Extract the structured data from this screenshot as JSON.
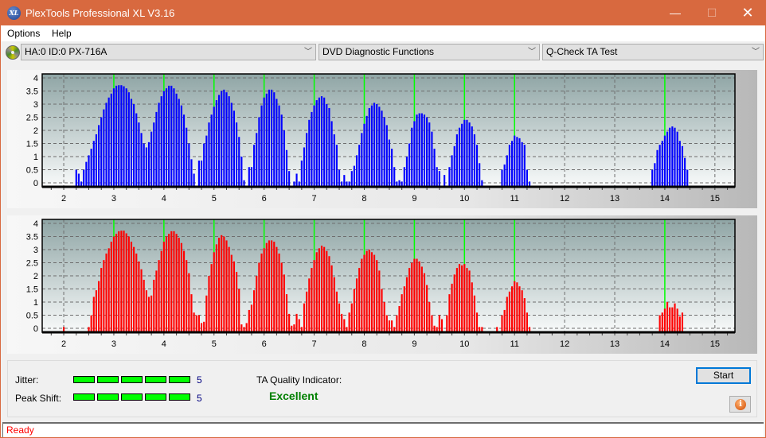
{
  "window": {
    "title": "PlexTools Professional XL V3.16",
    "logo_text": "XL",
    "controls": {
      "minimize": "—",
      "maximize": "☐",
      "close": "✕"
    }
  },
  "menu": {
    "items": [
      "Options",
      "Help"
    ]
  },
  "toolbar": {
    "drive": "HA:0 ID:0  PX-716A",
    "function": "DVD Diagnostic Functions",
    "test": "Q-Check TA Test"
  },
  "chart_data": [
    {
      "type": "bar",
      "name": "top-ta-histogram",
      "color": "#0000ff",
      "x_start": 2.25,
      "x_step": 0.05,
      "xlim": [
        1.57,
        15.4
      ],
      "ylim": [
        -0.15,
        4.15
      ],
      "x_ticks": [
        2,
        3,
        4,
        5,
        6,
        7,
        8,
        9,
        10,
        11,
        12,
        13,
        14,
        15
      ],
      "y_ticks": [
        0,
        0.5,
        1,
        1.5,
        2,
        2.5,
        3,
        3.5,
        4
      ],
      "y_tick_labels": [
        "0",
        "0.5",
        "1",
        "1.5",
        "2",
        "2.5",
        "3",
        "3.5",
        "4"
      ],
      "reference_lines": [
        3,
        4,
        5,
        6,
        7,
        8,
        9,
        10,
        11,
        14
      ],
      "reference_color": "#00ff00",
      "grid": true,
      "values": [
        0.5,
        0.35,
        0.05,
        0.5,
        0.8,
        1.05,
        1.3,
        1.6,
        1.85,
        2.2,
        2.5,
        2.8,
        3.05,
        3.25,
        3.4,
        3.6,
        3.7,
        3.72,
        3.72,
        3.68,
        3.6,
        3.45,
        3.2,
        3.0,
        2.65,
        2.3,
        1.9,
        1.5,
        1.35,
        1.55,
        1.95,
        2.3,
        2.7,
        3.05,
        3.3,
        3.5,
        3.6,
        3.7,
        3.7,
        3.6,
        3.4,
        3.2,
        2.95,
        2.6,
        2.1,
        1.5,
        0.9,
        0.35,
        0.0,
        0.85,
        0.85,
        1.5,
        1.8,
        2.3,
        2.6,
        2.9,
        3.15,
        3.35,
        3.5,
        3.55,
        3.45,
        3.3,
        3.05,
        2.75,
        2.3,
        1.75,
        1.0,
        0.1,
        0.0,
        0.6,
        0.6,
        1.45,
        1.9,
        2.5,
        2.95,
        3.25,
        3.4,
        3.55,
        3.55,
        3.45,
        3.2,
        2.95,
        2.6,
        2.0,
        1.25,
        0.45,
        0.0,
        0.05,
        0.35,
        0.05,
        0.85,
        1.35,
        1.9,
        2.4,
        2.7,
        2.95,
        3.15,
        3.25,
        3.3,
        3.25,
        3.0,
        2.85,
        2.35,
        1.85,
        1.45,
        0.5,
        0.05,
        0.3,
        0.05,
        0.05,
        0.45,
        0.65,
        1.05,
        1.45,
        1.9,
        2.25,
        2.55,
        2.85,
        2.95,
        3.05,
        3.0,
        2.9,
        2.75,
        2.5,
        2.2,
        1.65,
        1.3,
        0.6,
        0.05,
        0.1,
        0.05,
        0.6,
        1.0,
        1.5,
        2.1,
        2.35,
        2.6,
        2.65,
        2.65,
        2.6,
        2.5,
        2.3,
        1.95,
        1.3,
        0.6,
        0.45,
        0.0,
        0.3,
        0.0,
        0.6,
        1.05,
        1.4,
        1.85,
        2.1,
        2.25,
        2.4,
        2.4,
        2.3,
        2.15,
        1.85,
        1.45,
        0.75,
        0.1,
        0.0,
        0.0,
        0.0,
        0.0,
        0.0,
        0.0,
        0.0,
        0.5,
        0.7,
        1.05,
        1.45,
        1.6,
        1.8,
        1.75,
        1.7,
        1.55,
        1.45,
        0.5,
        0.05,
        0.0
      ],
      "values_end_x": 11.45,
      "extra_group": {
        "x_start": 13.75,
        "values": [
          0.5,
          0.75,
          1.25,
          1.45,
          1.6,
          1.8,
          1.95,
          2.1,
          2.15,
          2.1,
          1.95,
          1.6,
          1.4,
          0.95,
          0.5
        ]
      }
    },
    {
      "type": "bar",
      "name": "bottom-ta-histogram",
      "color": "#ff0000",
      "x_start": 2.25,
      "x_step": 0.05,
      "xlim": [
        1.57,
        15.4
      ],
      "ylim": [
        -0.15,
        4.15
      ],
      "x_ticks": [
        2,
        3,
        4,
        5,
        6,
        7,
        8,
        9,
        10,
        11,
        12,
        13,
        14,
        15
      ],
      "y_ticks": [
        0,
        0.5,
        1,
        1.5,
        2,
        2.5,
        3,
        3.5,
        4
      ],
      "y_tick_labels": [
        "0",
        "0.5",
        "1",
        "1.5",
        "2",
        "2.5",
        "3",
        "3.5",
        "4"
      ],
      "reference_lines": [
        3,
        4,
        5,
        6,
        7,
        8,
        9,
        10,
        11,
        14
      ],
      "reference_color": "#00ff00",
      "grid": true,
      "single_points": [
        {
          "x": 2.0,
          "value": 0.05
        }
      ],
      "values": [
        0.0,
        0.0,
        0.0,
        0.0,
        0.0,
        0.05,
        0.5,
        1.2,
        1.45,
        1.8,
        2.3,
        2.6,
        2.85,
        3.05,
        3.3,
        3.5,
        3.6,
        3.7,
        3.72,
        3.72,
        3.62,
        3.5,
        3.3,
        3.1,
        2.85,
        2.55,
        2.25,
        1.85,
        1.45,
        1.2,
        1.25,
        1.85,
        2.2,
        2.6,
        2.95,
        3.3,
        3.5,
        3.6,
        3.7,
        3.7,
        3.6,
        3.45,
        3.25,
        2.95,
        2.6,
        2.1,
        1.3,
        0.6,
        0.5,
        0.5,
        0.2,
        0.25,
        1.25,
        2.0,
        2.45,
        2.9,
        3.2,
        3.45,
        3.55,
        3.5,
        3.35,
        3.1,
        2.8,
        2.55,
        2.15,
        1.5,
        0.15,
        0.05,
        0.2,
        0.7,
        0.9,
        1.45,
        2.0,
        2.5,
        2.85,
        3.05,
        3.25,
        3.35,
        3.35,
        3.3,
        3.1,
        2.85,
        2.5,
        2.05,
        1.3,
        0.55,
        0.1,
        0.15,
        0.55,
        0.35,
        0.05,
        0.95,
        1.4,
        1.9,
        2.3,
        2.6,
        2.9,
        3.05,
        3.15,
        3.1,
        2.95,
        2.75,
        2.4,
        1.95,
        1.4,
        0.95,
        0.55,
        0.35,
        0.05,
        0.6,
        0.95,
        1.5,
        1.9,
        2.3,
        2.65,
        2.8,
        2.95,
        3.0,
        2.9,
        2.8,
        2.6,
        2.2,
        1.5,
        1.0,
        0.5,
        0.3,
        0.3,
        0.05,
        0.5,
        0.85,
        1.3,
        1.6,
        1.95,
        2.3,
        2.5,
        2.65,
        2.65,
        2.55,
        2.35,
        2.1,
        1.65,
        1.0,
        0.5,
        0.1,
        0.05,
        0.5,
        0.35,
        0.0,
        0.5,
        1.3,
        1.7,
        2.05,
        2.3,
        2.45,
        2.4,
        2.45,
        2.3,
        2.2,
        1.75,
        1.25,
        0.6,
        0.05,
        0.05,
        0.0,
        0.0,
        0.0,
        0.0,
        0.0,
        0.05,
        0.0,
        0.5,
        0.7,
        1.2,
        1.4,
        1.6,
        1.8,
        1.75,
        1.6,
        1.45,
        1.15,
        0.6,
        0.05
      ],
      "values_end_x": 11.5,
      "extra_group": {
        "x_start": 13.9,
        "values": [
          0.5,
          0.6,
          0.75,
          1.0,
          0.8,
          0.8,
          0.95,
          0.75,
          0.45,
          0.6
        ]
      }
    }
  ],
  "results": {
    "jitter_label": "Jitter:",
    "jitter_value": "5",
    "jitter_level": 5,
    "jitter_max": 5,
    "peak_shift_label": "Peak Shift:",
    "peak_shift_value": "5",
    "peak_shift_level": 5,
    "peak_shift_max": 5,
    "ta_quality_label": "TA Quality Indicator:",
    "ta_quality_value": "Excellent",
    "meter_color": "#00ff00",
    "quality_color": "#008000"
  },
  "buttons": {
    "start": "Start",
    "info_icon_text": "i"
  },
  "status": {
    "text": "Ready",
    "color": "#ff0000"
  }
}
